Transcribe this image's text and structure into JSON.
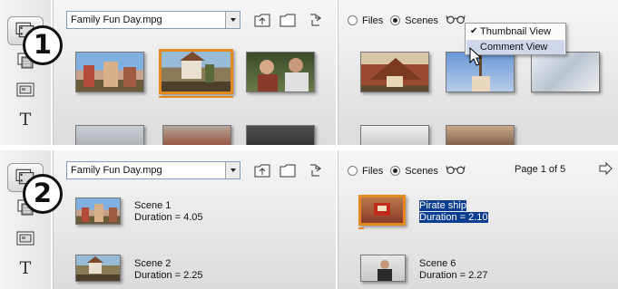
{
  "step_numbers": [
    "1",
    "2"
  ],
  "icons": {
    "sidebar": [
      "video-scenes-icon",
      "transitions-icon",
      "photos-icon",
      "titles-icon"
    ],
    "toolbar": [
      "folder-up-icon",
      "folder-icon",
      "browse-icon"
    ],
    "view": "glasses-icon",
    "next": "next-page-icon",
    "check": "checkmark-icon"
  },
  "sidebar": {
    "titles_glyph": "T"
  },
  "panel1": {
    "file_select": {
      "value": "Family Fun Day.mpg"
    },
    "source": {
      "files_label": "Files",
      "scenes_label": "Scenes",
      "selected": "Scenes"
    },
    "view_menu": {
      "items": [
        {
          "label": "Thumbnail View",
          "checked": true
        },
        {
          "label": "Comment View",
          "checked": false,
          "highlighted": true
        }
      ]
    }
  },
  "panel2": {
    "file_select": {
      "value": "Family Fun Day.mpg"
    },
    "source": {
      "files_label": "Files",
      "scenes_label": "Scenes",
      "selected": "Scenes"
    },
    "page_indicator": "Page 1 of 5",
    "scenes": [
      {
        "name": "Scene 1",
        "duration": "Duration = 4.05"
      },
      {
        "name": "Scene 2",
        "duration": "Duration = 2.25"
      },
      {
        "name": "Pirate ship",
        "duration": "Duration = 2.10",
        "selected": true
      },
      {
        "name": "Scene 6",
        "duration": "Duration = 2.27"
      }
    ]
  },
  "colors": {
    "selection_orange": "#e2891f",
    "text_selection_blue": "#0b3d91",
    "menu_highlight": "#cfd8ea"
  }
}
